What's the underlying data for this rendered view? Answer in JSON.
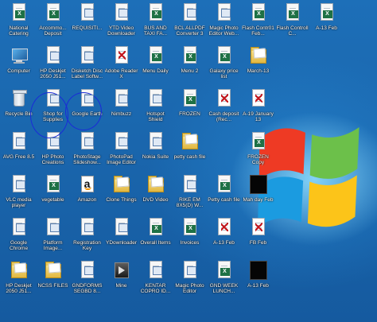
{
  "desktop": {
    "icons": [
      {
        "label": "National Catering",
        "glyph": "excel"
      },
      {
        "label": "Accommo... Deposit",
        "glyph": "excel"
      },
      {
        "label": "REQUISITI...",
        "glyph": "shortcut"
      },
      {
        "label": "YTD Video Downloader",
        "glyph": "shortcut"
      },
      {
        "label": "BUS AND TAXI FA...",
        "glyph": "excel"
      },
      {
        "label": "BCL ALLPDF Converter 3",
        "glyph": "shortcut"
      },
      {
        "label": "Magic Photo Editor Web...",
        "glyph": "shortcut"
      },
      {
        "label": "Flash Contr01 Feb...",
        "glyph": "excel"
      },
      {
        "label": "Flash Controll C...",
        "glyph": "excel"
      },
      {
        "label": "A-13 Feb",
        "glyph": "excel"
      },
      {
        "label": "Computer",
        "glyph": "computer"
      },
      {
        "label": "HP Deskjet 2050 J51...",
        "glyph": "shortcut"
      },
      {
        "label": "Disketch Disc Label Softw...",
        "glyph": "shortcut"
      },
      {
        "label": "Adobe Reader X",
        "glyph": "pdf"
      },
      {
        "label": "Menu Daily",
        "glyph": "excel"
      },
      {
        "label": "Menu 2",
        "glyph": "excel"
      },
      {
        "label": "Galaxy price list",
        "glyph": "excel"
      },
      {
        "label": "March-13",
        "glyph": "folder"
      },
      {
        "label": "",
        "glyph": "none"
      },
      {
        "label": "",
        "glyph": "none"
      },
      {
        "label": "Recycle Bin",
        "glyph": "bin"
      },
      {
        "label": "Shop for Supplies",
        "glyph": "shortcut"
      },
      {
        "label": "Google Earth",
        "glyph": "shortcut"
      },
      {
        "label": "Nimbuzz",
        "glyph": "shortcut"
      },
      {
        "label": "Hotspot Shield",
        "glyph": "shortcut"
      },
      {
        "label": "FROZEN",
        "glyph": "excel"
      },
      {
        "label": "Cash deposit (Rec...",
        "glyph": "pdf"
      },
      {
        "label": "A-19 January 13",
        "glyph": "pdf"
      },
      {
        "label": "",
        "glyph": "none"
      },
      {
        "label": "",
        "glyph": "none"
      },
      {
        "label": "AVG Free 8.5",
        "glyph": "shortcut"
      },
      {
        "label": "HP Photo Creations",
        "glyph": "shortcut"
      },
      {
        "label": "PhotoStage Slideshow...",
        "glyph": "shortcut"
      },
      {
        "label": "PhotoPad Image Editor",
        "glyph": "shortcut"
      },
      {
        "label": "Nokia Suite",
        "glyph": "shortcut"
      },
      {
        "label": "petty cash file",
        "glyph": "folder"
      },
      {
        "label": "",
        "glyph": "none"
      },
      {
        "label": "FROZEN Copy",
        "glyph": "excel"
      },
      {
        "label": "",
        "glyph": "none"
      },
      {
        "label": "",
        "glyph": "none"
      },
      {
        "label": "VLC media player",
        "glyph": "shortcut"
      },
      {
        "label": "vegetable",
        "glyph": "excel"
      },
      {
        "label": "Amazon",
        "glyph": "amazon"
      },
      {
        "label": "Clone Things",
        "glyph": "folder"
      },
      {
        "label": "DVD Video",
        "glyph": "folder"
      },
      {
        "label": "RIKE EM 8X5(D) W...",
        "glyph": "shortcut"
      },
      {
        "label": "Petty cash file",
        "glyph": "excel"
      },
      {
        "label": "Mah day Feb",
        "glyph": "black"
      },
      {
        "label": "",
        "glyph": "none"
      },
      {
        "label": "",
        "glyph": "none"
      },
      {
        "label": "Google Chrome",
        "glyph": "shortcut"
      },
      {
        "label": "Platform Image...",
        "glyph": "shortcut"
      },
      {
        "label": "Registration Key",
        "glyph": "shortcut"
      },
      {
        "label": "YDownloader",
        "glyph": "shortcut"
      },
      {
        "label": "Overall Items",
        "glyph": "excel"
      },
      {
        "label": "Invoices",
        "glyph": "excel"
      },
      {
        "label": "A-13 Feb",
        "glyph": "pdf"
      },
      {
        "label": "FB Feb",
        "glyph": "pdf"
      },
      {
        "label": "",
        "glyph": "none"
      },
      {
        "label": "",
        "glyph": "none"
      },
      {
        "label": "HP Deskjet 2050 J51...",
        "glyph": "folder"
      },
      {
        "label": "NCSS FILES",
        "glyph": "folder"
      },
      {
        "label": "GNDFORMS SEGBD 8...",
        "glyph": "shortcut"
      },
      {
        "label": "Mine",
        "glyph": "media"
      },
      {
        "label": "KENTAR COPRO ID...",
        "glyph": "shortcut"
      },
      {
        "label": "Magic Photo Editor",
        "glyph": "shortcut"
      },
      {
        "label": "GND WEEK LUNCH...",
        "glyph": "excel"
      },
      {
        "label": "A-13 Feb",
        "glyph": "black"
      },
      {
        "label": "",
        "glyph": "none"
      },
      {
        "label": "",
        "glyph": "none"
      }
    ]
  }
}
